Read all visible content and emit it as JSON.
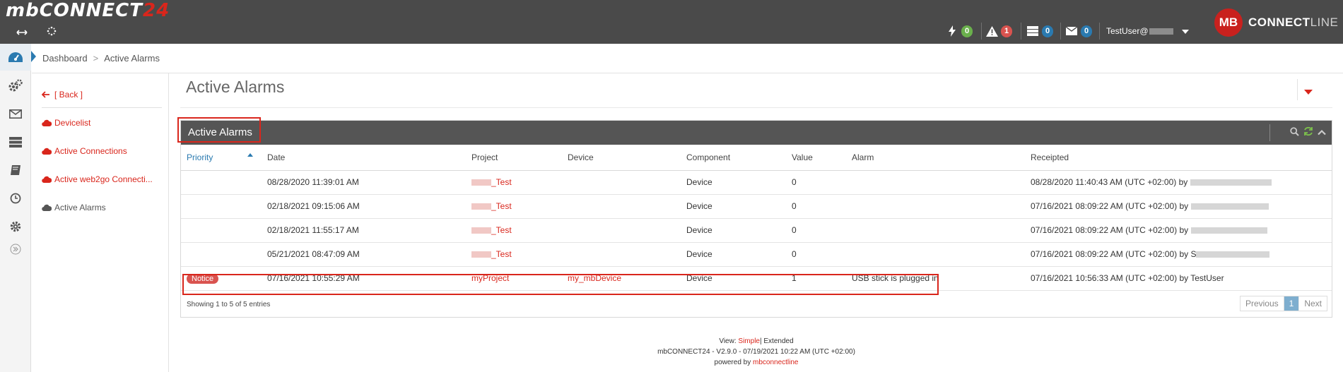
{
  "app": {
    "logo_main": "mbCONNECT",
    "logo_num": "24",
    "brand_mark": "MB",
    "brand_text_a": "CONNECT",
    "brand_text_b": "LINE"
  },
  "topbar": {
    "expand_icon": "arrows-horizontal-icon",
    "spinner_icon": "spinner-icon",
    "stats": [
      {
        "icon": "bolt-icon",
        "count": "0",
        "color": "#6ab04c"
      },
      {
        "icon": "warning-icon",
        "count": "1",
        "color": "#d9534f"
      },
      {
        "icon": "server-icon",
        "count": "0",
        "color": "#2a7ab0"
      },
      {
        "icon": "envelope-icon",
        "count": "0",
        "color": "#2a7ab0"
      }
    ],
    "user": "TestUser@"
  },
  "breadcrumb": {
    "root": "Dashboard",
    "separator": ">",
    "current": "Active Alarms"
  },
  "sidebar_icons": [
    "dashboard-icon",
    "cogs-icon",
    "envelope-icon",
    "server-icon",
    "book-icon",
    "clock-icon",
    "gear-icon",
    "expand-chevron-icon"
  ],
  "sidemenu": {
    "back": "[ Back ]",
    "items": [
      {
        "label": "Devicelist"
      },
      {
        "label": "Active Connections"
      },
      {
        "label": "Active web2go Connecti..."
      },
      {
        "label": "Active Alarms"
      }
    ]
  },
  "page": {
    "title": "Active Alarms",
    "panel_title": "Active Alarms"
  },
  "table": {
    "columns": [
      "Priority",
      "Date",
      "Project",
      "Device",
      "Component",
      "Value",
      "Alarm",
      "Receipted"
    ],
    "rows": [
      {
        "priority": "",
        "date": "08/28/2020 11:39:01 AM",
        "project": "_Test",
        "device": "",
        "component": "Device",
        "value": "0",
        "alarm": "",
        "receipted": "08/28/2020 11:40:43 AM (UTC +02:00) by"
      },
      {
        "priority": "",
        "date": "02/18/2021 09:15:06 AM",
        "project": "_Test",
        "device": "",
        "component": "Device",
        "value": "0",
        "alarm": "",
        "receipted": "07/16/2021 08:09:22 AM (UTC +02:00) by"
      },
      {
        "priority": "",
        "date": "02/18/2021 11:55:17 AM",
        "project": "_Test",
        "device": "",
        "component": "Device",
        "value": "0",
        "alarm": "",
        "receipted": "07/16/2021 08:09:22 AM (UTC +02:00) by"
      },
      {
        "priority": "",
        "date": "05/21/2021 08:47:09 AM",
        "project": "_Test",
        "device": "",
        "component": "Device",
        "value": "0",
        "alarm": "",
        "receipted": "07/16/2021 08:09:22 AM (UTC +02:00) by S"
      },
      {
        "priority": "Notice",
        "date": "07/16/2021 10:55:29 AM",
        "project": "myProject",
        "device": "my_mbDevice",
        "component": "Device",
        "value": "1",
        "alarm": "USB stick is plugged in",
        "receipted": "07/16/2021 10:56:33 AM (UTC +02:00) by TestUser"
      }
    ],
    "showing": "Showing 1 to 5 of 5 entries",
    "pager": {
      "prev": "Previous",
      "page": "1",
      "next": "Next"
    }
  },
  "footer": {
    "view_label": "View:",
    "view_simple": "Simple",
    "view_sep": "|",
    "view_extended": "Extended",
    "version": "mbCONNECT24 - V2.9.0 - 07/19/2021 10:22 AM (UTC +02:00)",
    "powered_by": "powered by",
    "powered_link": "mbconnectline"
  }
}
